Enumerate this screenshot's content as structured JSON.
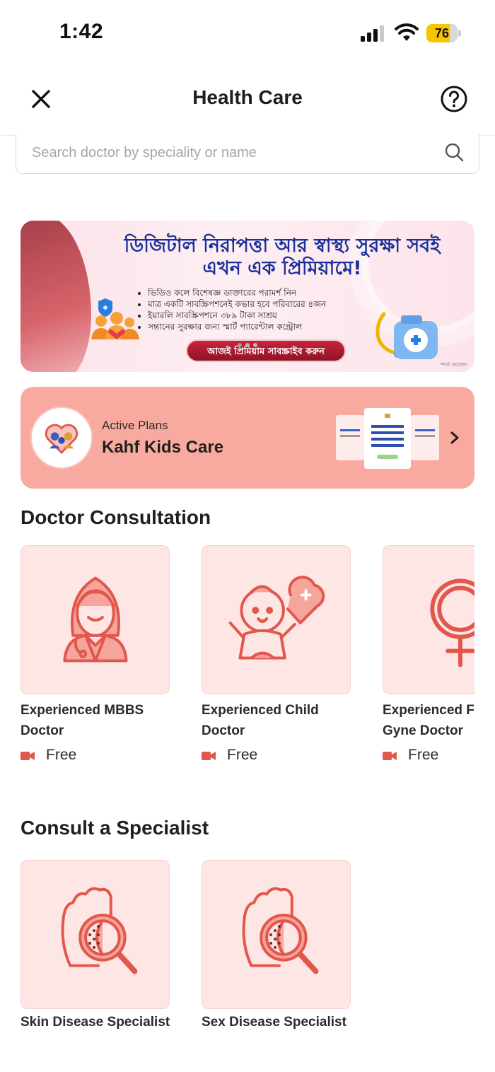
{
  "status_bar": {
    "time": "1:42",
    "battery": "76",
    "battery_level": 0.76
  },
  "header": {
    "title": "Health Care"
  },
  "search": {
    "placeholder": "Search doctor by speciality or name"
  },
  "banner": {
    "headline": "ডিজিটাল নিরাপত্তা আর স্বাস্থ্য সুরক্ষা সবই এখন এক প্রিমিয়ামে!",
    "bullets": [
      "ভিডিও কলে বিশেষজ্ঞ ডাক্তারের পরামর্শ নিন",
      "মাত্র একটি সাবস্ক্রিপশনেই কভার হবে পরিবারের ৪জন",
      "ইয়ারলি সাবস্ক্রিপশনে ৩৮৯ টাকা সাশ্রয়",
      "সন্তানের সুরক্ষার জন্য স্মার্ট প্যারেন্টাল কন্ট্রোল"
    ],
    "cta": "আজই প্রিমিয়াম সাবস্ক্রাইব করুন",
    "fine_print": "*শর্ত প্রযোজ্য"
  },
  "active_plan": {
    "label": "Active Plans",
    "name": "Kahf Kids Care"
  },
  "doctor_consultation": {
    "title": "Doctor Consultation",
    "items": [
      {
        "line1": "Experienced MBBS",
        "line2": "Doctor",
        "price": "Free",
        "icon": "female-doctor-icon"
      },
      {
        "line1": "Experienced Child",
        "line2": "Doctor",
        "price": "Free",
        "icon": "baby-heart-icon"
      },
      {
        "line1": "Experienced Fe",
        "line2": "Gyne Doctor",
        "price": "Free",
        "icon": "female-symbol-icon"
      }
    ]
  },
  "specialists": {
    "title": "Consult a Specialist",
    "items": [
      {
        "label": "Skin Disease Specialist",
        "icon": "skin-magnifier-icon"
      },
      {
        "label": "Sex Disease Specialist",
        "icon": "skin-magnifier-icon"
      }
    ]
  },
  "colors": {
    "accent": "#e2574c",
    "card_bg": "#fde6e4",
    "plan_bg": "#f9aaa0",
    "banner_blue": "#1a2f9c"
  }
}
